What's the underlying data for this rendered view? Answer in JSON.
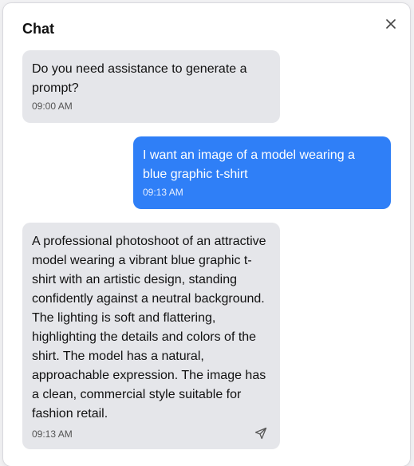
{
  "dialog": {
    "title": "Chat"
  },
  "messages": [
    {
      "role": "assistant",
      "text": "Do you need assistance to generate a prompt?",
      "time": "09:00 AM"
    },
    {
      "role": "user",
      "text": "I want an image of a model wearing a blue graphic t-shirt",
      "time": "09:13 AM"
    },
    {
      "role": "assistant",
      "text": "A professional photoshoot of an attractive model wearing a vibrant blue graphic t-shirt with an artistic design, standing confidently against a neutral background. The lighting is soft and flattering, highlighting the details and colors of the shirt. The model has a natural, approachable expression. The image has a clean, commercial style suitable for fashion retail.",
      "time": "09:13 AM"
    }
  ],
  "icons": {
    "close": "close-icon",
    "send": "send-icon"
  },
  "colors": {
    "user_bubble": "#2f7ff7",
    "assistant_bubble": "#e5e6ea"
  }
}
